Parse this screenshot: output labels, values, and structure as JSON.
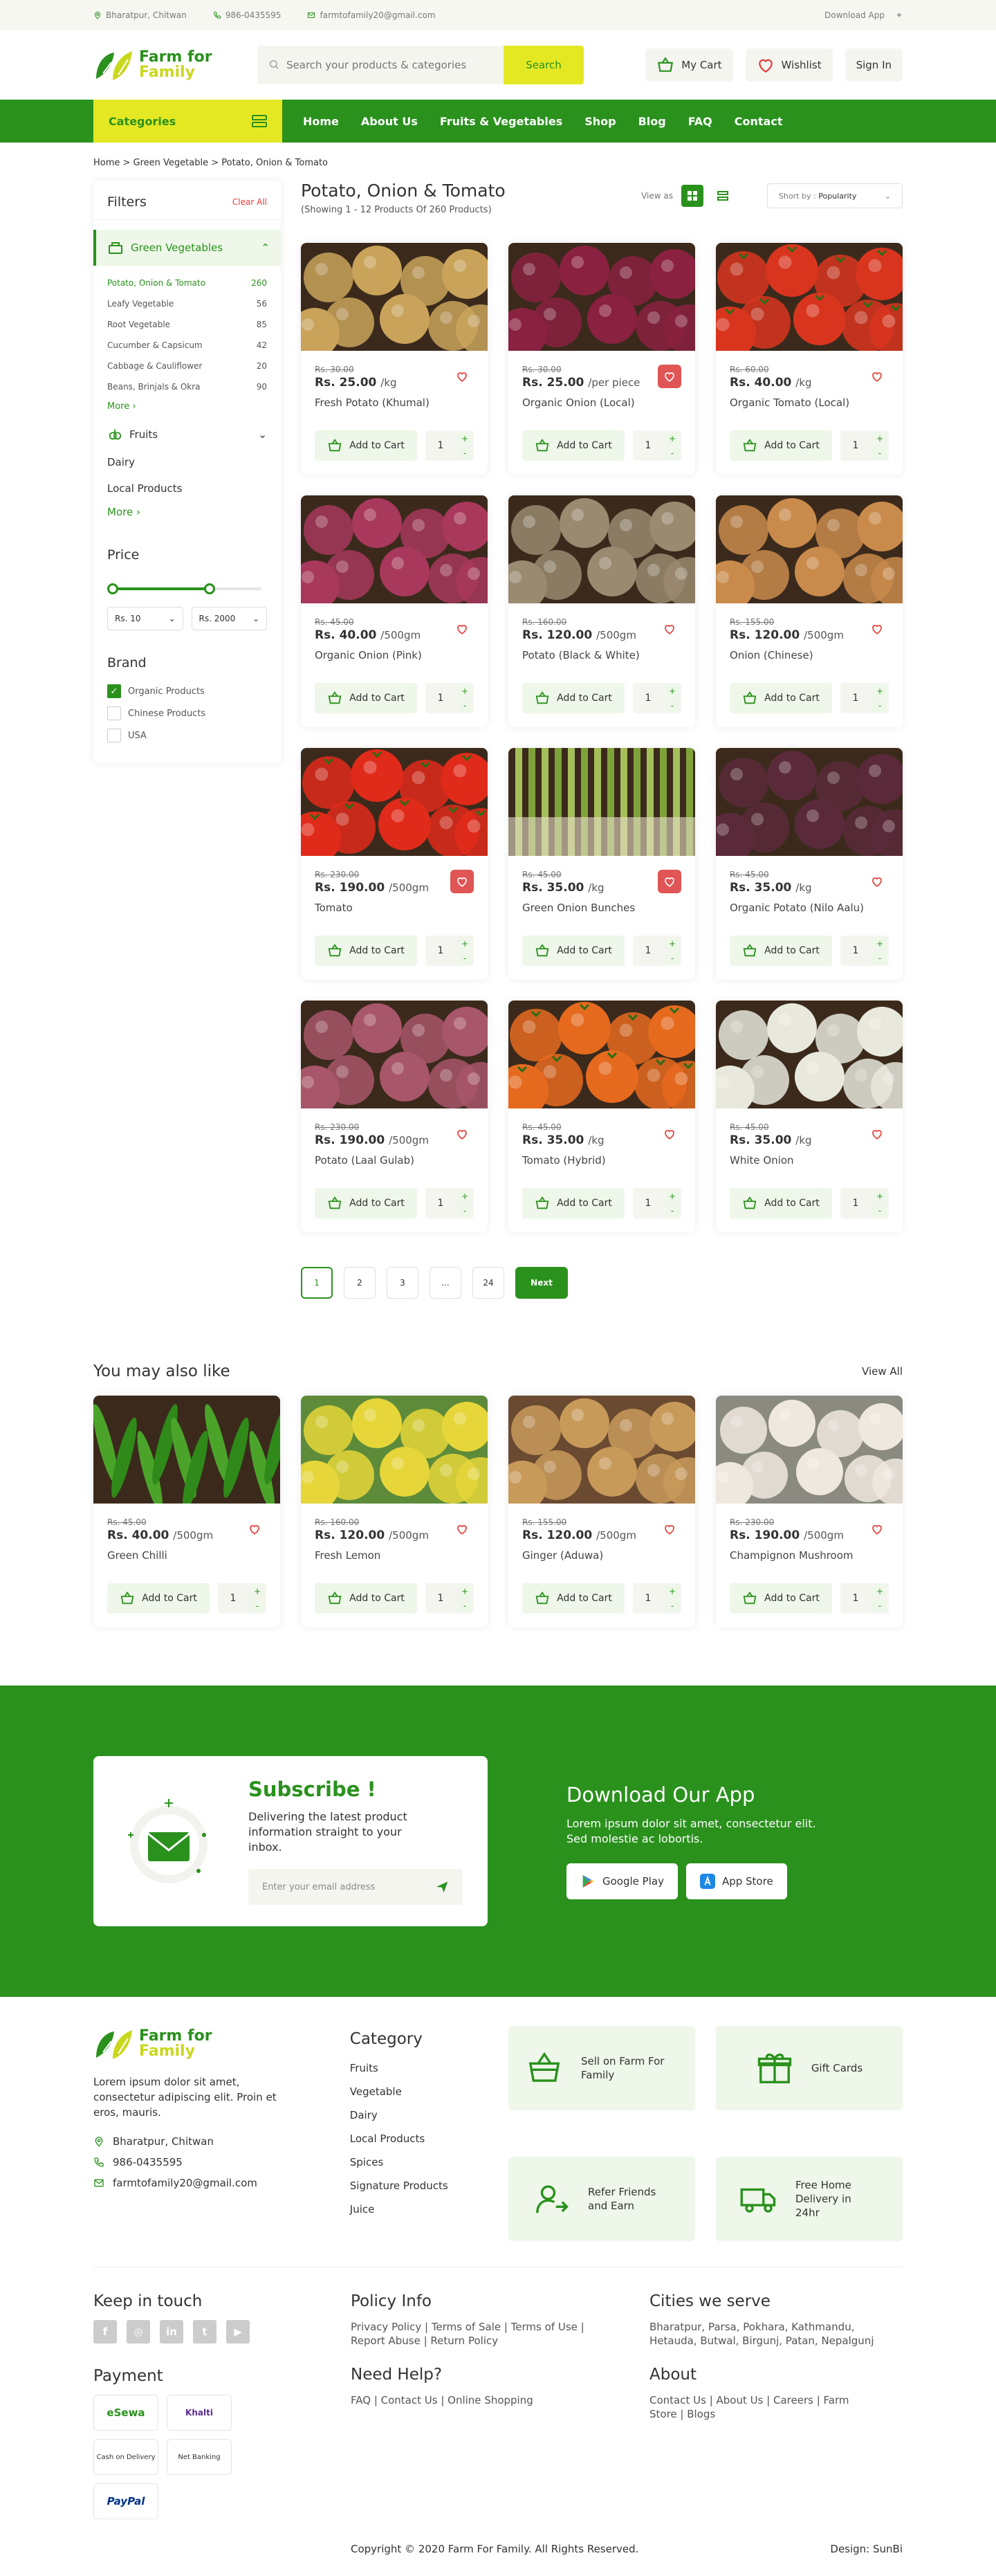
{
  "topbar": {
    "address": "Bharatpur, Chitwan",
    "phone": "986-0435595",
    "email": "farmtofamily20@gmail.com",
    "download": "Download App"
  },
  "brand": {
    "line1": "Farm for",
    "line2": "Family"
  },
  "search": {
    "placeholder": "Search your products & categories",
    "button": "Search"
  },
  "header": {
    "cart": "My Cart",
    "wishlist": "Wishlist",
    "signin": "Sign In"
  },
  "nav": {
    "categories": "Categories",
    "links": [
      "Home",
      "About Us",
      "Fruits & Vegetables",
      "Shop",
      "Blog",
      "FAQ",
      "Contact"
    ]
  },
  "breadcrumb": "Home > Green Vegetable > Potato, Onion & Tomato",
  "filters": {
    "title": "Filters",
    "clear": "Clear All",
    "active_category": "Green Vegetables",
    "subcategories": [
      {
        "name": "Potato, Onion & Tomato",
        "count": "260"
      },
      {
        "name": "Leafy Vegetable",
        "count": "56"
      },
      {
        "name": "Root Vegetable",
        "count": "85"
      },
      {
        "name": "Cucumber & Capsicum",
        "count": "42"
      },
      {
        "name": "Cabbage & Cauliflower",
        "count": "20"
      },
      {
        "name": "Beans, Brinjals & Okra",
        "count": "90"
      }
    ],
    "more": "More",
    "fruits": "Fruits",
    "dairy": "Dairy",
    "local": "Local Products",
    "more2": "More",
    "price_title": "Price",
    "price_min": "Rs. 10",
    "price_max": "Rs. 2000",
    "price_range": [
      0,
      0.6
    ],
    "brand_title": "Brand",
    "brands": [
      {
        "name": "Organic Products",
        "checked": true
      },
      {
        "name": "Chinese Products",
        "checked": false
      },
      {
        "name": "USA",
        "checked": false
      }
    ]
  },
  "listing": {
    "title": "Potato, Onion & Tomato",
    "subtitle": "(Showing 1 - 12 Products Of 260 Products)",
    "view_as": "View as",
    "sort_label": "Short by :",
    "sort_value": "Popularity"
  },
  "products": [
    {
      "old": "Rs. 30.00",
      "price": "Rs. 25.00",
      "unit": "/kg",
      "name": "Fresh Potato (Khumal)",
      "fav": false,
      "img": "potato-icon",
      "color": "#c9a35a"
    },
    {
      "old": "Rs. 30.00",
      "price": "Rs. 25.00",
      "unit": "/per piece",
      "name": "Organic Onion (Local)",
      "fav": true,
      "img": "onion-icon",
      "color": "#8a2140"
    },
    {
      "old": "Rs. 60.00",
      "price": "Rs. 40.00",
      "unit": "/kg",
      "name": "Organic Tomato (Local)",
      "fav": false,
      "img": "tomato-icon",
      "color": "#d9351e"
    },
    {
      "old": "Rs. 45.00",
      "price": "Rs. 40.00",
      "unit": "/500gm",
      "name": "Organic Onion (Pink)",
      "fav": false,
      "img": "onion-icon",
      "color": "#a8385c"
    },
    {
      "old": "Rs. 160.00",
      "price": "Rs. 120.00",
      "unit": "/500gm",
      "name": "Potato (Black & White)",
      "fav": false,
      "img": "potato-icon",
      "color": "#9a8a70"
    },
    {
      "old": "Rs. 155.00",
      "price": "Rs. 120.00",
      "unit": "/500gm",
      "name": "Onion (Chinese)",
      "fav": false,
      "img": "onion-icon",
      "color": "#c98b4b"
    },
    {
      "old": "Rs. 230.00",
      "price": "Rs. 190.00",
      "unit": "/500gm",
      "name": "Tomato",
      "fav": true,
      "img": "tomato-icon",
      "color": "#e02a1a"
    },
    {
      "old": "Rs. 45.00",
      "price": "Rs. 35.00",
      "unit": "/kg",
      "name": "Green Onion Bunches",
      "fav": true,
      "img": "green-onion-icon",
      "color": "#8fa34a"
    },
    {
      "old": "Rs. 45.00",
      "price": "Rs. 35.00",
      "unit": "/kg",
      "name": "Organic Potato (Nilo Aalu)",
      "fav": false,
      "img": "potato-icon",
      "color": "#5a2a3a"
    },
    {
      "old": "Rs. 230.00",
      "price": "Rs. 190.00",
      "unit": "/500gm",
      "name": "Potato (Laal Gulab)",
      "fav": false,
      "img": "potato-icon",
      "color": "#a8566a"
    },
    {
      "old": "Rs. 45.00",
      "price": "Rs. 35.00",
      "unit": "/kg",
      "name": "Tomato (Hybrid)",
      "fav": false,
      "img": "tomato-icon",
      "color": "#e66a1e"
    },
    {
      "old": "Rs. 45.00",
      "price": "Rs. 35.00",
      "unit": "/kg",
      "name": "White Onion",
      "fav": false,
      "img": "onion-icon",
      "color": "#e8e8dc"
    }
  ],
  "card": {
    "add": "Add to Cart",
    "qty": "1",
    "plus": "+",
    "minus": "-"
  },
  "pagination": [
    "1",
    "2",
    "3",
    "...",
    "24"
  ],
  "next": "Next",
  "also": {
    "title": "You may also like",
    "view_all": "View All",
    "items": [
      {
        "old": "Rs. 45.00",
        "price": "Rs. 40.00",
        "unit": "/500gm",
        "name": "Green Chilli",
        "img": "chilli-icon",
        "color": "#3a8f1f"
      },
      {
        "old": "Rs. 160.00",
        "price": "Rs. 120.00",
        "unit": "/500gm",
        "name": "Fresh Lemon",
        "img": "lemon-icon",
        "color": "#e6d63a"
      },
      {
        "old": "Rs. 155.00",
        "price": "Rs. 120.00",
        "unit": "/500gm",
        "name": "Ginger (Aduwa)",
        "img": "ginger-icon",
        "color": "#c89a5a"
      },
      {
        "old": "Rs. 230.00",
        "price": "Rs. 190.00",
        "unit": "/500gm",
        "name": "Champignon Mushroom",
        "img": "mushroom-icon",
        "color": "#efe8de"
      }
    ]
  },
  "subscribe": {
    "title": "Subscribe !",
    "text": "Delivering the latest product information straight to your inbox.",
    "placeholder": "Enter your email address"
  },
  "app": {
    "title": "Download Our App",
    "text": "Lorem ipsum dolor sit amet, consectetur elit. Sed molestie ac lobortis.",
    "google": "Google Play",
    "apple": "App Store"
  },
  "footer": {
    "desc": "Lorem ipsum dolor sit amet, consectetur adipiscing elit. Proin et eros, mauris.",
    "address": "Bharatpur, Chitwan",
    "phone": "986-0435595",
    "email": "farmtofamily20@gmail.com",
    "category_title": "Category",
    "categories": [
      "Fruits",
      "Vegetable",
      "Dairy",
      "Local Products",
      "Spices",
      "Signature Products",
      "Juice"
    ],
    "features": [
      {
        "label": "Sell on Farm For Family",
        "icon": "basket-icon"
      },
      {
        "label": "Gift Cards",
        "icon": "gift-icon"
      },
      {
        "label": "Refer Friends and Earn",
        "icon": "refer-icon"
      },
      {
        "label": "Free Home Delivery in 24hr",
        "icon": "truck-icon"
      }
    ],
    "keep": "Keep in touch",
    "policy_title": "Policy Info",
    "policy": "Privacy Policy | Terms of Sale | Terms of Use | Report Abuse | Return Policy",
    "cities_title": "Cities we serve",
    "cities": "Bharatpur, Parsa, Pokhara, Kathmandu, Hetauda, Butwal, Birgunj, Patan, Nepalgunj",
    "payment": "Payment",
    "payments": [
      "eSewa",
      "Khalti",
      "Cash on Delivery",
      "Net Banking",
      "PayPal"
    ],
    "help_title": "Need Help?",
    "help": "FAQ | Contact Us | Online Shopping",
    "about_title": "About",
    "about": "Contact Us | About Us | Careers | Farm Store | Blogs",
    "copyright": "Copyright © 2020 Farm For Family. All Rights Reserved.",
    "design": "Design: SunBi"
  }
}
